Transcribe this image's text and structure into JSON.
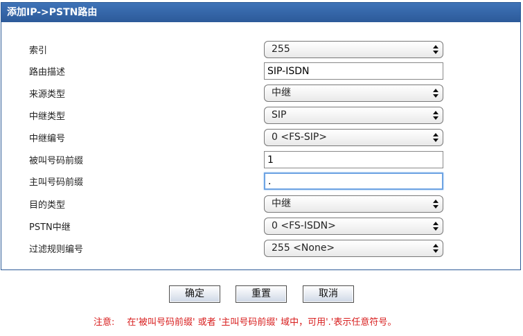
{
  "header": {
    "title": "添加IP->PSTN路由"
  },
  "form": {
    "rows": [
      {
        "label": "索引",
        "type": "select",
        "value": "255"
      },
      {
        "label": "路由描述",
        "type": "text",
        "value": "SIP-ISDN"
      },
      {
        "label": "来源类型",
        "type": "select",
        "value": "中继"
      },
      {
        "label": "中继类型",
        "type": "select",
        "value": "SIP"
      },
      {
        "label": "中继编号",
        "type": "select",
        "value": "0 <FS-SIP>"
      },
      {
        "label": "被叫号码前缀",
        "type": "text",
        "value": "1"
      },
      {
        "label": "主叫号码前缀",
        "type": "text",
        "value": "."
      },
      {
        "label": "目的类型",
        "type": "select",
        "value": "中继"
      },
      {
        "label": "PSTN中继",
        "type": "select",
        "value": "0 <FS-ISDN>"
      },
      {
        "label": "过滤规则编号",
        "type": "select",
        "value": "255 <None>"
      }
    ]
  },
  "buttons": {
    "ok": "确定",
    "reset": "重置",
    "cancel": "取消"
  },
  "note": {
    "prefix": "注意:",
    "text": "在'被叫号码前缀' 或者 '主叫号码前缀' 域中，可用'.'表示任意符号。"
  }
}
